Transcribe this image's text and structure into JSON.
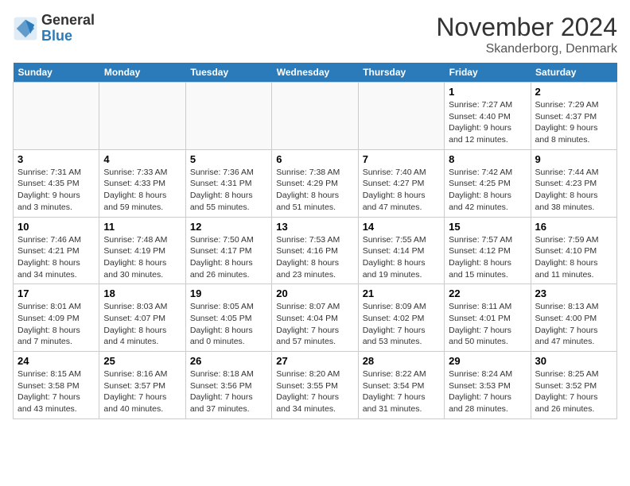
{
  "logo": {
    "general": "General",
    "blue": "Blue"
  },
  "header": {
    "month": "November 2024",
    "location": "Skanderborg, Denmark"
  },
  "weekdays": [
    "Sunday",
    "Monday",
    "Tuesday",
    "Wednesday",
    "Thursday",
    "Friday",
    "Saturday"
  ],
  "weeks": [
    [
      {
        "day": "",
        "info": "",
        "empty": true
      },
      {
        "day": "",
        "info": "",
        "empty": true
      },
      {
        "day": "",
        "info": "",
        "empty": true
      },
      {
        "day": "",
        "info": "",
        "empty": true
      },
      {
        "day": "",
        "info": "",
        "empty": true
      },
      {
        "day": "1",
        "info": "Sunrise: 7:27 AM\nSunset: 4:40 PM\nDaylight: 9 hours and 12 minutes."
      },
      {
        "day": "2",
        "info": "Sunrise: 7:29 AM\nSunset: 4:37 PM\nDaylight: 9 hours and 8 minutes."
      }
    ],
    [
      {
        "day": "3",
        "info": "Sunrise: 7:31 AM\nSunset: 4:35 PM\nDaylight: 9 hours and 3 minutes."
      },
      {
        "day": "4",
        "info": "Sunrise: 7:33 AM\nSunset: 4:33 PM\nDaylight: 8 hours and 59 minutes."
      },
      {
        "day": "5",
        "info": "Sunrise: 7:36 AM\nSunset: 4:31 PM\nDaylight: 8 hours and 55 minutes."
      },
      {
        "day": "6",
        "info": "Sunrise: 7:38 AM\nSunset: 4:29 PM\nDaylight: 8 hours and 51 minutes."
      },
      {
        "day": "7",
        "info": "Sunrise: 7:40 AM\nSunset: 4:27 PM\nDaylight: 8 hours and 47 minutes."
      },
      {
        "day": "8",
        "info": "Sunrise: 7:42 AM\nSunset: 4:25 PM\nDaylight: 8 hours and 42 minutes."
      },
      {
        "day": "9",
        "info": "Sunrise: 7:44 AM\nSunset: 4:23 PM\nDaylight: 8 hours and 38 minutes."
      }
    ],
    [
      {
        "day": "10",
        "info": "Sunrise: 7:46 AM\nSunset: 4:21 PM\nDaylight: 8 hours and 34 minutes."
      },
      {
        "day": "11",
        "info": "Sunrise: 7:48 AM\nSunset: 4:19 PM\nDaylight: 8 hours and 30 minutes."
      },
      {
        "day": "12",
        "info": "Sunrise: 7:50 AM\nSunset: 4:17 PM\nDaylight: 8 hours and 26 minutes."
      },
      {
        "day": "13",
        "info": "Sunrise: 7:53 AM\nSunset: 4:16 PM\nDaylight: 8 hours and 23 minutes."
      },
      {
        "day": "14",
        "info": "Sunrise: 7:55 AM\nSunset: 4:14 PM\nDaylight: 8 hours and 19 minutes."
      },
      {
        "day": "15",
        "info": "Sunrise: 7:57 AM\nSunset: 4:12 PM\nDaylight: 8 hours and 15 minutes."
      },
      {
        "day": "16",
        "info": "Sunrise: 7:59 AM\nSunset: 4:10 PM\nDaylight: 8 hours and 11 minutes."
      }
    ],
    [
      {
        "day": "17",
        "info": "Sunrise: 8:01 AM\nSunset: 4:09 PM\nDaylight: 8 hours and 7 minutes."
      },
      {
        "day": "18",
        "info": "Sunrise: 8:03 AM\nSunset: 4:07 PM\nDaylight: 8 hours and 4 minutes."
      },
      {
        "day": "19",
        "info": "Sunrise: 8:05 AM\nSunset: 4:05 PM\nDaylight: 8 hours and 0 minutes."
      },
      {
        "day": "20",
        "info": "Sunrise: 8:07 AM\nSunset: 4:04 PM\nDaylight: 7 hours and 57 minutes."
      },
      {
        "day": "21",
        "info": "Sunrise: 8:09 AM\nSunset: 4:02 PM\nDaylight: 7 hours and 53 minutes."
      },
      {
        "day": "22",
        "info": "Sunrise: 8:11 AM\nSunset: 4:01 PM\nDaylight: 7 hours and 50 minutes."
      },
      {
        "day": "23",
        "info": "Sunrise: 8:13 AM\nSunset: 4:00 PM\nDaylight: 7 hours and 47 minutes."
      }
    ],
    [
      {
        "day": "24",
        "info": "Sunrise: 8:15 AM\nSunset: 3:58 PM\nDaylight: 7 hours and 43 minutes."
      },
      {
        "day": "25",
        "info": "Sunrise: 8:16 AM\nSunset: 3:57 PM\nDaylight: 7 hours and 40 minutes."
      },
      {
        "day": "26",
        "info": "Sunrise: 8:18 AM\nSunset: 3:56 PM\nDaylight: 7 hours and 37 minutes."
      },
      {
        "day": "27",
        "info": "Sunrise: 8:20 AM\nSunset: 3:55 PM\nDaylight: 7 hours and 34 minutes."
      },
      {
        "day": "28",
        "info": "Sunrise: 8:22 AM\nSunset: 3:54 PM\nDaylight: 7 hours and 31 minutes."
      },
      {
        "day": "29",
        "info": "Sunrise: 8:24 AM\nSunset: 3:53 PM\nDaylight: 7 hours and 28 minutes."
      },
      {
        "day": "30",
        "info": "Sunrise: 8:25 AM\nSunset: 3:52 PM\nDaylight: 7 hours and 26 minutes."
      }
    ]
  ]
}
